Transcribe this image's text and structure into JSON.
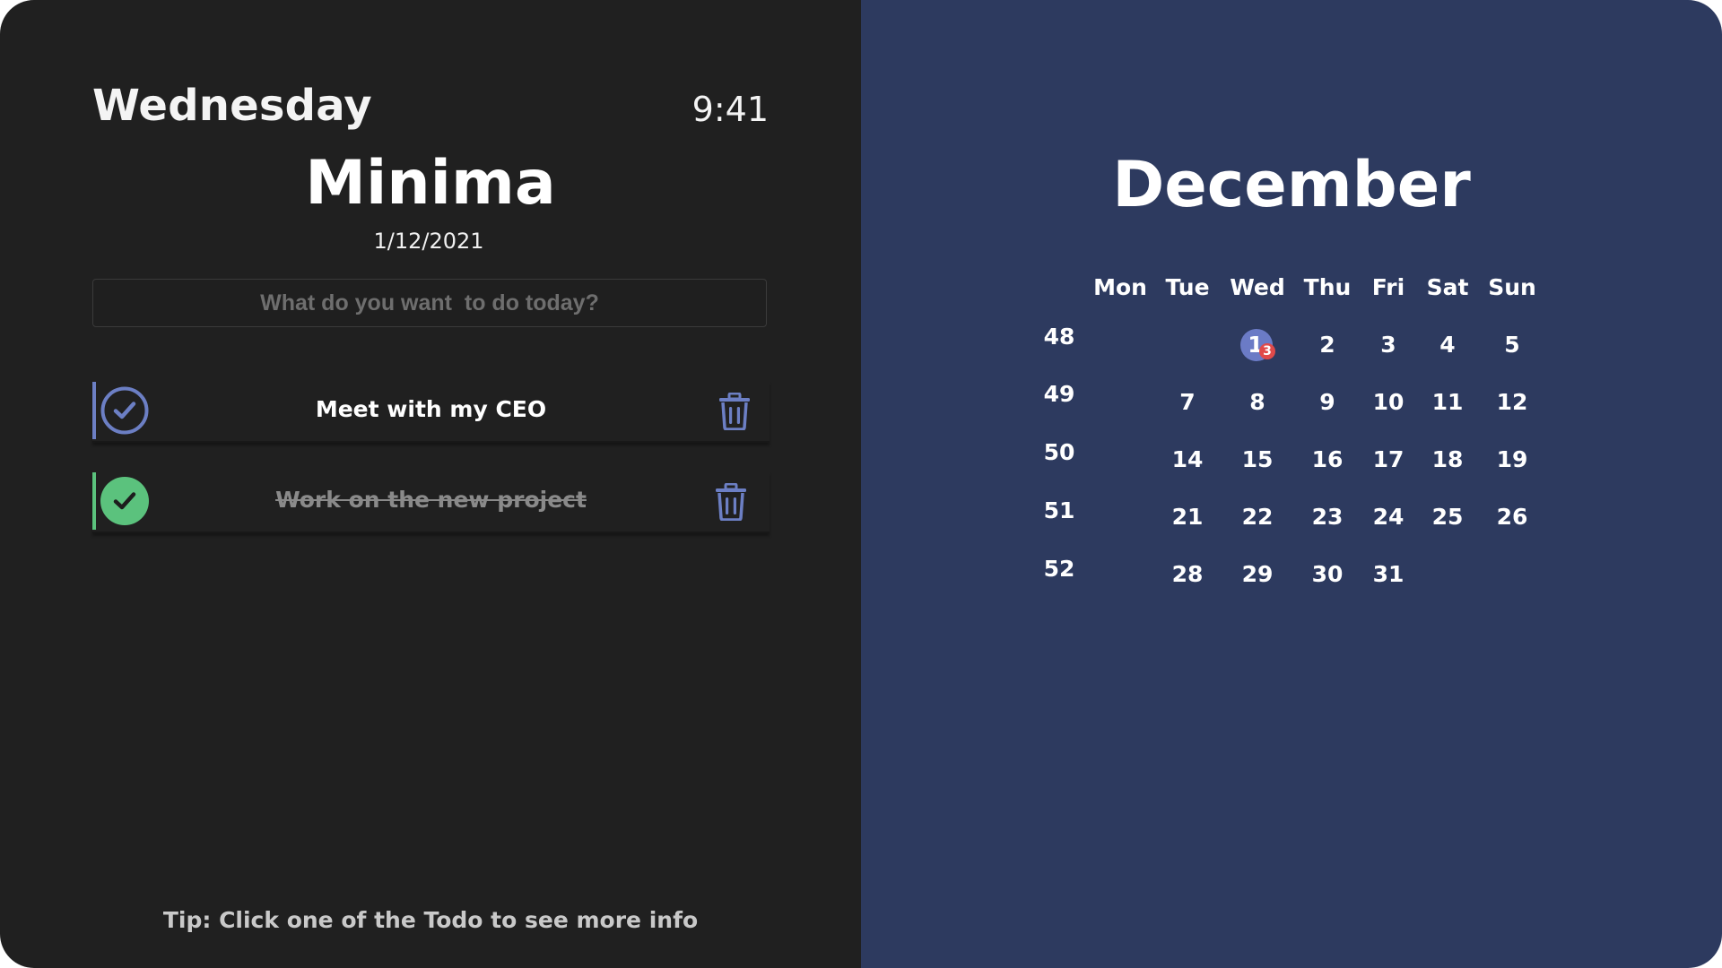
{
  "left": {
    "day_name": "Wednesday",
    "time": "9:41",
    "app_title": "Minima",
    "date": "1/12/2021",
    "input_placeholder": "What do you want  to do today?",
    "todos": [
      {
        "text": "Meet with my CEO",
        "completed": false,
        "accent": "#6c7fc4"
      },
      {
        "text": "Work on the new project",
        "completed": true,
        "accent": "#5bc27d"
      }
    ],
    "tip": "Tip: Click one of the Todo to see more info",
    "colors": {
      "background": "#202020",
      "pending_check": "#6c7fc4",
      "done_check": "#5bc27d",
      "trash": "#6c7fc4"
    },
    "icons": [
      "check-circle-outline-icon",
      "check-circle-filled-icon",
      "trash-icon"
    ]
  },
  "calendar": {
    "month": "December",
    "weekdays": [
      "Mon",
      "Tue",
      "Wed",
      "Thu",
      "Fri",
      "Sat",
      "Sun"
    ],
    "weeks": [
      {
        "number": "48",
        "days": [
          "",
          "",
          "1",
          "2",
          "3",
          "4",
          "5"
        ]
      },
      {
        "number": "49",
        "days": [
          "",
          "7",
          "8",
          "9",
          "10",
          "11",
          "12"
        ]
      },
      {
        "number": "50",
        "days": [
          "",
          "14",
          "15",
          "16",
          "17",
          "18",
          "19"
        ]
      },
      {
        "number": "51",
        "days": [
          "",
          "21",
          "22",
          "23",
          "24",
          "25",
          "26"
        ]
      },
      {
        "number": "52",
        "days": [
          "",
          "28",
          "29",
          "30",
          "31",
          "",
          ""
        ]
      }
    ],
    "today": {
      "day": "1",
      "badge": "3"
    },
    "colors": {
      "background": "#2d3a5f",
      "today_circle": "#6b7bc6",
      "badge": "#e04a4a"
    }
  }
}
